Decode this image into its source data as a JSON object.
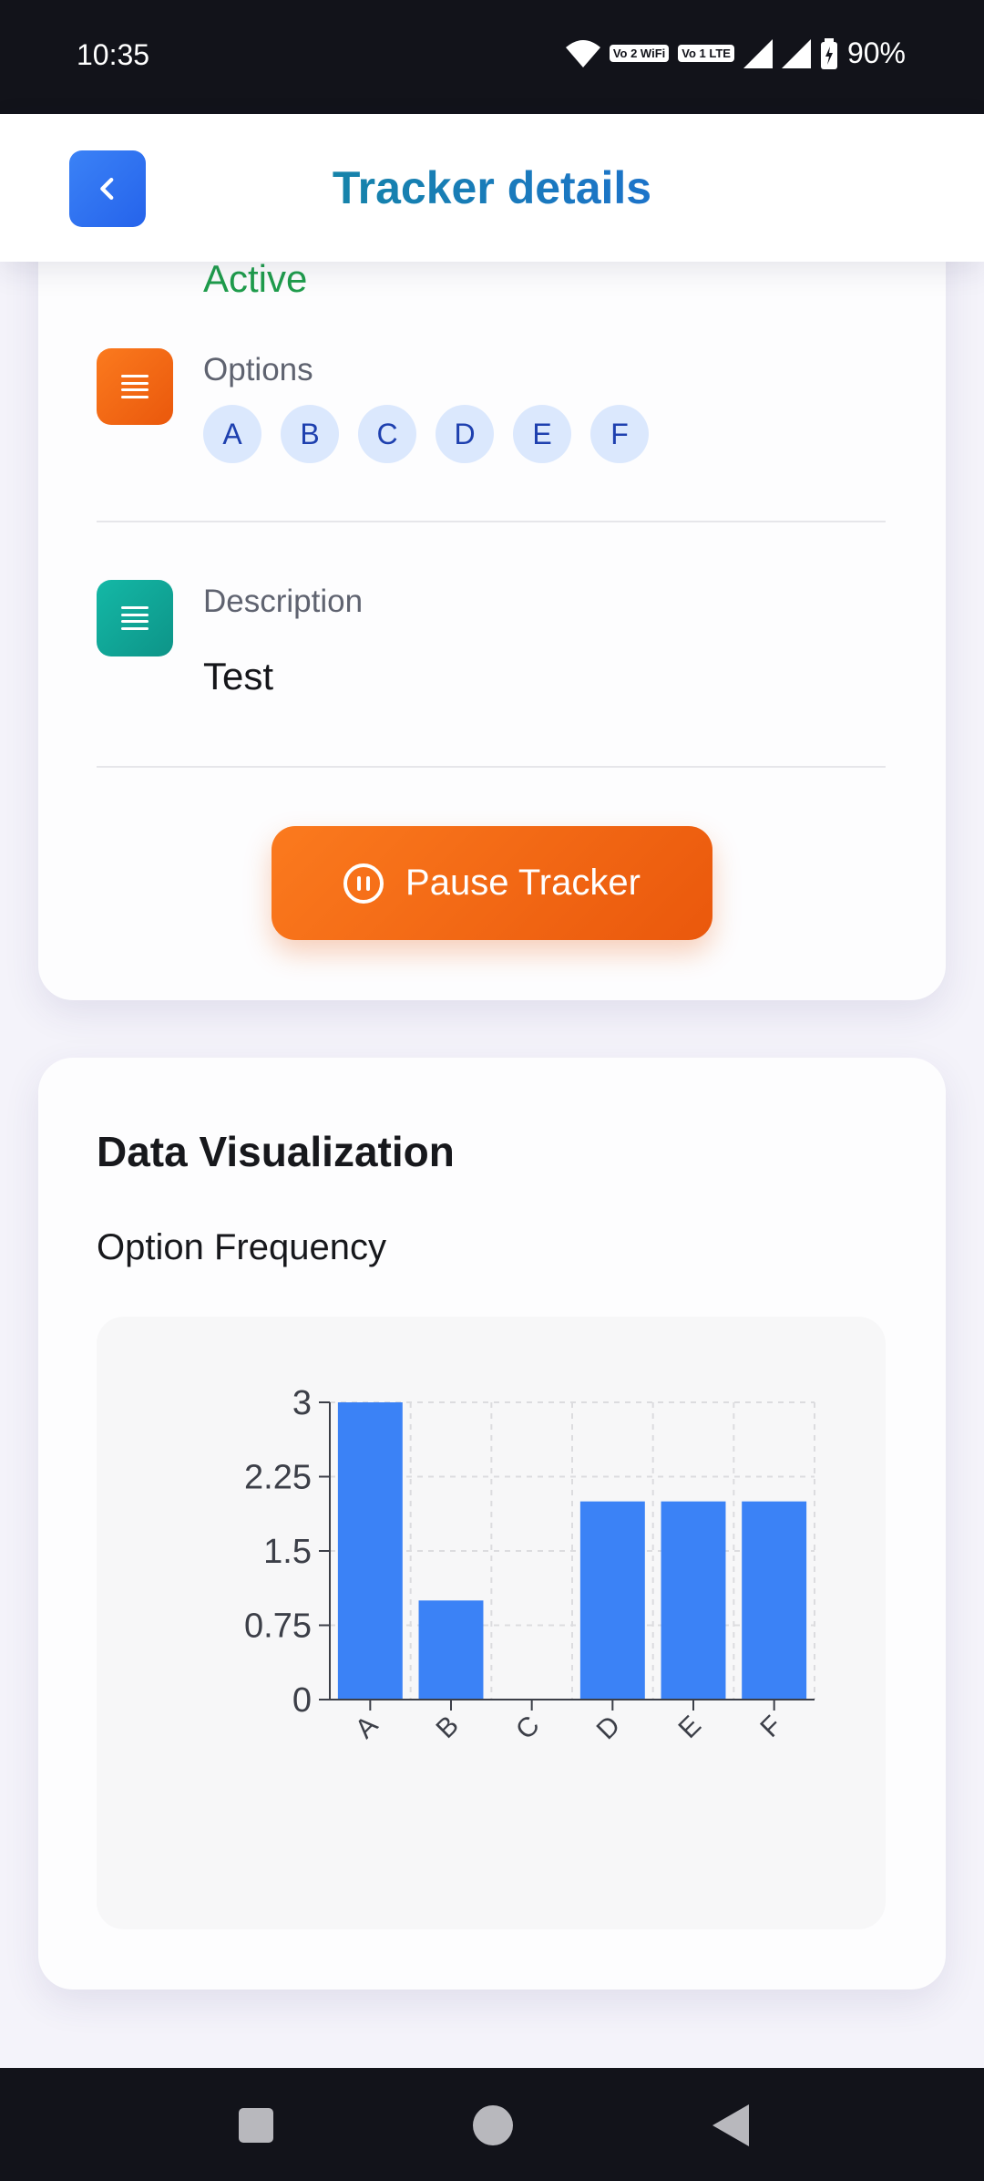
{
  "status_bar": {
    "time": "10:35",
    "vowifi_label": "Vo 2 WiFi",
    "volte_label": "Vo 1 LTE",
    "battery": "90%"
  },
  "header": {
    "title": "Tracker details",
    "back_icon": "chevron-left-icon"
  },
  "details": {
    "status_value": "Active",
    "options_label": "Options",
    "options": [
      "A",
      "B",
      "C",
      "D",
      "E",
      "F"
    ],
    "description_label": "Description",
    "description_value": "Test",
    "pause_button_label": "Pause Tracker",
    "colors": {
      "status": "#1f9d4c",
      "accent_orange": "#ea580c",
      "accent_teal": "#0d9488"
    }
  },
  "visualization": {
    "section_title": "Data Visualization",
    "chart_title": "Option Frequency"
  },
  "chart_data": {
    "type": "bar",
    "title": "Option Frequency",
    "categories": [
      "A",
      "B",
      "C",
      "D",
      "E",
      "F"
    ],
    "values": [
      3,
      1,
      0,
      2,
      2,
      2
    ],
    "ylim": [
      0,
      3
    ],
    "yticks": [
      "0",
      "0.75",
      "1.5",
      "2.25",
      "3"
    ],
    "ytick_values": [
      0,
      0.75,
      1.5,
      2.25,
      3
    ],
    "xlabel": "",
    "ylabel": "",
    "grid": true,
    "bar_color": "#3b82f6"
  }
}
